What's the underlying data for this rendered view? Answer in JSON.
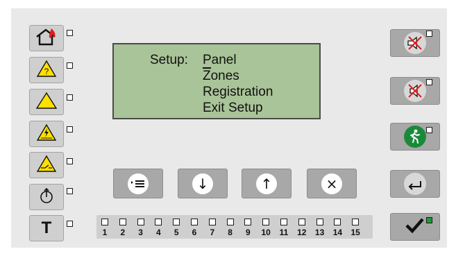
{
  "display": {
    "prefix": "Setup:",
    "lines": [
      "Panel",
      "Zones",
      "Registration",
      "Exit Setup"
    ],
    "selected_index": 0
  },
  "left_buttons": [
    {
      "icon": "fire-house-icon"
    },
    {
      "icon": "warning-question-icon"
    },
    {
      "icon": "warning-triangle-icon"
    },
    {
      "icon": "electrical-hazard-icon"
    },
    {
      "icon": "disablement-triangle-icon"
    },
    {
      "icon": "power-icon"
    },
    {
      "icon": "test-icon",
      "text": "T"
    }
  ],
  "nav_buttons": [
    {
      "name": "menu-button",
      "icon": "menu-icon",
      "glyph": "‣≡"
    },
    {
      "name": "down-button",
      "icon": "arrow-down-icon",
      "glyph": "↓"
    },
    {
      "name": "up-button",
      "icon": "arrow-up-icon",
      "glyph": "↑"
    },
    {
      "name": "cancel-button",
      "icon": "close-icon",
      "glyph": "×"
    }
  ],
  "right_buttons": [
    {
      "name": "silence-sounder-button",
      "icon": "silenced-sounder-icon"
    },
    {
      "name": "silence-buzzer-button",
      "icon": "muted-speaker-icon"
    },
    {
      "name": "evacuate-button",
      "icon": "evacuation-running-man-icon"
    },
    {
      "name": "back-button",
      "icon": "return-arrow-icon"
    },
    {
      "name": "confirm-button",
      "icon": "checkmark-icon"
    }
  ],
  "zones": [
    "1",
    "2",
    "3",
    "4",
    "5",
    "6",
    "7",
    "8",
    "9",
    "10",
    "11",
    "12",
    "13",
    "14",
    "15"
  ],
  "colors": {
    "lcd": "#a9c498",
    "confirm_led": "#1e9a3c",
    "fire": "#e11b1b",
    "warning": "#ffe000",
    "evacuate": "#1a8a3a"
  }
}
